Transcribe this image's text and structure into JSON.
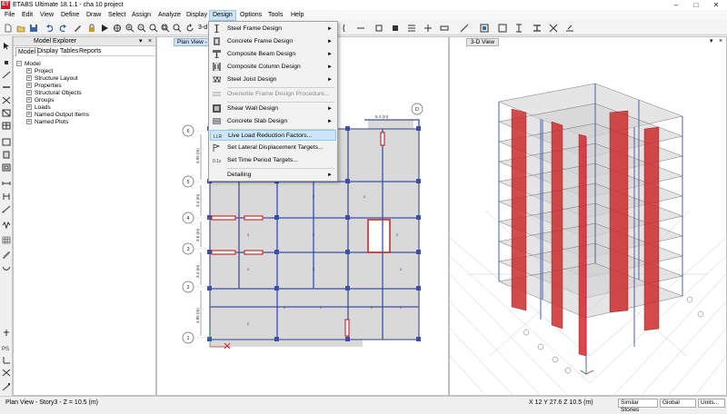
{
  "window": {
    "title": "ETABS Ultimate 18.1.1 - cha 10 project",
    "logo": "ET"
  },
  "menubar": [
    "File",
    "Edit",
    "View",
    "Define",
    "Draw",
    "Select",
    "Assign",
    "Analyze",
    "Display",
    "Design",
    "Options",
    "Tools",
    "Help"
  ],
  "toolbar": {
    "view_label": "3-d"
  },
  "explorer": {
    "title": "Model Explorer",
    "tabs": [
      "Model",
      "Display",
      "Tables",
      "Reports"
    ],
    "root": "Model",
    "items": [
      "Project",
      "Structure Layout",
      "Properties",
      "Structural Objects",
      "Groups",
      "Loads",
      "Named Output Items",
      "Named Plots"
    ]
  },
  "plan_view": {
    "tab": "Plan View - Story3 - Z = 10.5 (m)",
    "grid_rows": [
      "6",
      "5",
      "4",
      "3",
      "2",
      "1"
    ],
    "grid_col": "D",
    "dimensions": [
      "6.4 (m)",
      "4.95 (m)",
      "3.4 (m)",
      "3.6 (m)",
      "3.4 (m)",
      "4.85 (m)"
    ],
    "panel_marks": "2",
    "panel_marks_alt": "3"
  },
  "view_3d": {
    "tab": "3-D View"
  },
  "design_menu": {
    "items": [
      {
        "label": "Steel Frame Design",
        "icon": "steel-frame-icon",
        "arrow": true
      },
      {
        "label": "Concrete Frame Design",
        "icon": "concrete-frame-icon",
        "arrow": true
      },
      {
        "label": "Composite Beam Design",
        "icon": "composite-beam-icon",
        "arrow": true
      },
      {
        "label": "Composite Column Design",
        "icon": "composite-column-icon",
        "arrow": true
      },
      {
        "label": "Steel Joist Design",
        "icon": "steel-joist-icon",
        "arrow": true
      },
      {
        "label": "Overwrite Frame Design Procedure...",
        "icon": "overwrite-icon",
        "disabled": true
      },
      {
        "label": "Shear Wall Design",
        "icon": "shear-wall-icon",
        "arrow": true
      },
      {
        "label": "Concrete Slab Design",
        "icon": "concrete-slab-icon",
        "arrow": true
      },
      {
        "label": "Live Load Reduction Factors...",
        "icon": "llrf-icon",
        "highlighted": true
      },
      {
        "label": "Set Lateral Displacement Targets...",
        "icon": "displacement-icon"
      },
      {
        "label": "Set Time Period Targets...",
        "icon": "time-period-icon"
      },
      {
        "label": "Detailing",
        "icon": "detailing-icon",
        "arrow": true
      }
    ]
  },
  "statusbar": {
    "left": "Plan View - Story3 - Z = 10.5 (m)",
    "coords": "X 12  Y 27.6  Z 10.5 (m)",
    "stories": "Similar Stories",
    "coord_sys": "Global",
    "units": "Units..."
  },
  "colors": {
    "accent": "#cce4f7",
    "wall_red": "#cc2b2b",
    "beam_blue": "#3b4fa8",
    "grid_circle": "#666666"
  }
}
